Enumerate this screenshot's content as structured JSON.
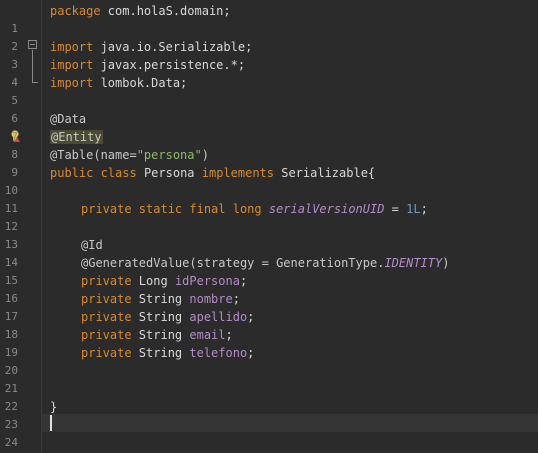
{
  "editor": {
    "lines": [
      {
        "n": "1"
      },
      {
        "n": "2"
      },
      {
        "n": "3"
      },
      {
        "n": "4"
      },
      {
        "n": "5"
      },
      {
        "n": "6"
      },
      {
        "n": "7"
      },
      {
        "n": "8"
      },
      {
        "n": "9"
      },
      {
        "n": "10"
      },
      {
        "n": "11"
      },
      {
        "n": "12"
      },
      {
        "n": "13"
      },
      {
        "n": "14"
      },
      {
        "n": "15"
      },
      {
        "n": "16"
      },
      {
        "n": "17"
      },
      {
        "n": "18"
      },
      {
        "n": "19"
      },
      {
        "n": "20"
      },
      {
        "n": "21"
      },
      {
        "n": "22"
      },
      {
        "n": "23"
      },
      {
        "n": "24"
      }
    ],
    "code": {
      "l1_kw": "package",
      "l1_rest": " com.holaS.domain;",
      "l3_kw": "import",
      "l3_rest": " java.io.Serializable;",
      "l4_kw": "import",
      "l4_rest": " javax.persistence.*;",
      "l5_kw": "import",
      "l5_rest": " lombok.Data;",
      "l7": "@Data",
      "l8": "@Entity",
      "l9_a": "@Table(name=",
      "l9_str": "\"persona\"",
      "l9_b": ")",
      "l10_kw1": "public",
      "l10_kw2": " class",
      "l10_a": " Persona ",
      "l10_kw3": "implements",
      "l10_b": " Serializable{",
      "l12_kw": "private static final long",
      "l12_field": " serialVersionUID",
      "l12_a": " = ",
      "l12_num": "1L",
      "l12_b": ";",
      "l14": "@Id",
      "l15_a": "@GeneratedValue(strategy = GenerationType.",
      "l15_it": "IDENTITY",
      "l15_b": ")",
      "l16_kw": "private",
      "l16_type": " Long ",
      "l16_field": "idPersona",
      "l17_kw": "private",
      "l17_type": " String ",
      "l17_field": "nombre",
      "l18_kw": "private",
      "l18_type": " String ",
      "l18_field": "apellido",
      "l19_kw": "private",
      "l19_type": " String ",
      "l19_field": "email",
      "l20_kw": "private",
      "l20_type": " String ",
      "l20_field": "telefono",
      "semi": ";",
      "l23": "}"
    }
  },
  "colors": {
    "background": "#2b2b2b",
    "keyword": "#d98a2e",
    "string": "#8fb96a",
    "field": "#b58bc8",
    "number": "#6d9cbe"
  },
  "icons": {
    "fold": "fold-collapse-icon",
    "hint": "lightbulb-warning-icon"
  }
}
